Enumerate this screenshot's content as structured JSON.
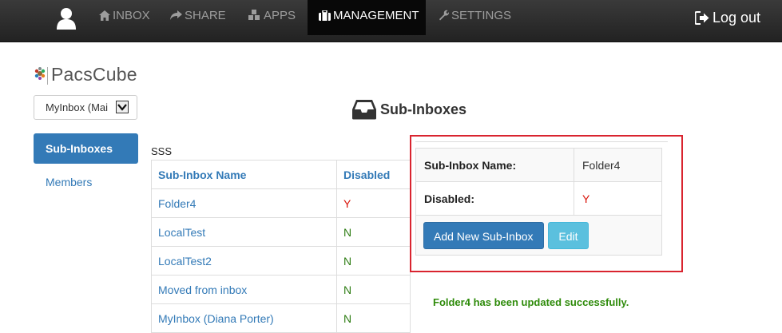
{
  "nav": {
    "items": [
      {
        "label": "INBOX",
        "icon": "home-icon"
      },
      {
        "label": "SHARE",
        "icon": "share-icon"
      },
      {
        "label": "APPS",
        "icon": "apps-icon"
      },
      {
        "label": "MANAGEMENT",
        "icon": "briefcase-icon",
        "active": true
      },
      {
        "label": "SETTINGS",
        "icon": "wrench-icon"
      }
    ],
    "logout_label": "Log out"
  },
  "sidebar": {
    "logo_text": "PacsCube",
    "inbox_select_value": "MyInbox (Mai",
    "items": [
      {
        "label": "Sub-Inboxes",
        "active": true
      },
      {
        "label": "Members"
      }
    ]
  },
  "main": {
    "title": "Sub-Inboxes",
    "caption": "SSS",
    "table": {
      "headers": [
        "Sub-Inbox Name",
        "Disabled"
      ],
      "rows": [
        {
          "name": "Folder4",
          "disabled": "Y"
        },
        {
          "name": "LocalTest",
          "disabled": "N"
        },
        {
          "name": "LocalTest2",
          "disabled": "N"
        },
        {
          "name": "Moved from inbox",
          "disabled": "N"
        },
        {
          "name": "MyInbox (Diana Porter)",
          "disabled": "N"
        }
      ]
    },
    "detail": {
      "name_label": "Sub-Inbox Name:",
      "name_value": "Folder4",
      "disabled_label": "Disabled:",
      "disabled_value": "Y",
      "add_button": "Add New Sub-Inbox",
      "edit_button": "Edit"
    },
    "success_message": "Folder4 has been updated successfully."
  },
  "colors": {
    "accent": "#337ab7",
    "highlight_frame": "#d9242f",
    "flag_yes": "#d9140a",
    "flag_no": "#2e7d14",
    "success": "#2e8b0a"
  }
}
